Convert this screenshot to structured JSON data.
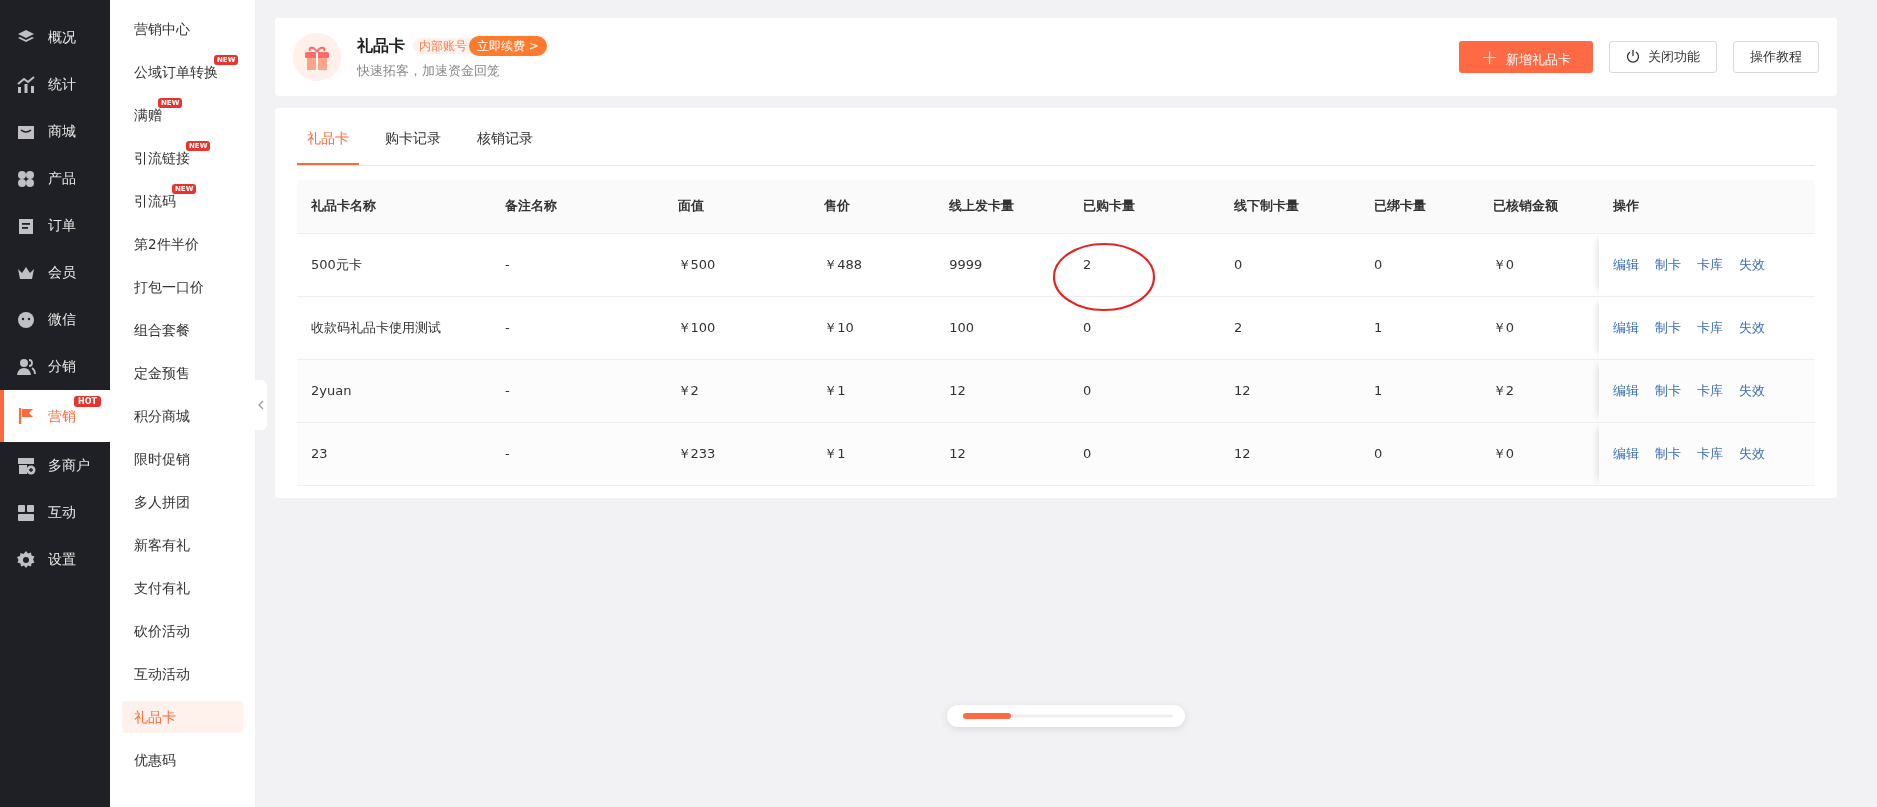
{
  "nav": [
    {
      "label": "概况",
      "selected": false
    },
    {
      "label": "统计",
      "selected": false
    },
    {
      "label": "商城",
      "selected": false
    },
    {
      "label": "产品",
      "selected": false
    },
    {
      "label": "订单",
      "selected": false
    },
    {
      "label": "会员",
      "selected": false
    },
    {
      "label": "微信",
      "selected": false
    },
    {
      "label": "分销",
      "selected": false
    },
    {
      "label": "营销",
      "selected": true,
      "badge": "HOT"
    },
    {
      "label": "多商户",
      "selected": false
    },
    {
      "label": "互动",
      "selected": false
    },
    {
      "label": "设置",
      "selected": false
    }
  ],
  "submenu": [
    {
      "label": "营销中心",
      "selected": false
    },
    {
      "label": "公域订单转换",
      "selected": false,
      "badge": "NEW"
    },
    {
      "label": "满赠",
      "selected": false,
      "badge": "NEW"
    },
    {
      "label": "引流链接",
      "selected": false,
      "badge": "NEW"
    },
    {
      "label": "引流码",
      "selected": false,
      "badge": "NEW"
    },
    {
      "label": "第2件半价",
      "selected": false
    },
    {
      "label": "打包一口价",
      "selected": false
    },
    {
      "label": "组合套餐",
      "selected": false
    },
    {
      "label": "定金预售",
      "selected": false
    },
    {
      "label": "积分商城",
      "selected": false
    },
    {
      "label": "限时促销",
      "selected": false
    },
    {
      "label": "多人拼团",
      "selected": false
    },
    {
      "label": "新客有礼",
      "selected": false
    },
    {
      "label": "支付有礼",
      "selected": false
    },
    {
      "label": "砍价活动",
      "selected": false
    },
    {
      "label": "互动活动",
      "selected": false
    },
    {
      "label": "礼品卡",
      "selected": true
    },
    {
      "label": "优惠码",
      "selected": false
    }
  ],
  "header": {
    "title": "礼品卡",
    "account_tag": "内部账号",
    "renew_button": "立即续费 >",
    "subtitle": "快速拓客，加速资金回笼",
    "buttons": [
      {
        "label": "新增礼品卡",
        "kind": "primary",
        "icon": "+"
      },
      {
        "label": "关闭功能",
        "kind": "power"
      },
      {
        "label": "操作教程",
        "kind": "plain"
      }
    ]
  },
  "tabs": [
    {
      "label": "礼品卡",
      "selected": true
    },
    {
      "label": "购卡记录",
      "selected": false
    },
    {
      "label": "核销记录",
      "selected": false
    }
  ],
  "table": {
    "columns": [
      "礼品卡名称",
      "备注名称",
      "面值",
      "售价",
      "线上发卡量",
      "已购卡量",
      "线下制卡量",
      "已绑卡量",
      "已核销金额",
      "操作"
    ],
    "rows": [
      {
        "cells": [
          {
            "text": "500元卡",
            "circled": false
          },
          {
            "text": "-",
            "circled": false
          },
          {
            "text": "￥500",
            "circled": false
          },
          {
            "text": "￥488",
            "circled": false
          },
          {
            "text": "9999",
            "circled": false
          },
          {
            "text": "2",
            "circled": true
          },
          {
            "text": "0",
            "circled": false
          },
          {
            "text": "0",
            "circled": false
          },
          {
            "text": "￥0",
            "circled": false
          }
        ],
        "actions": [
          "编辑",
          "制卡",
          "卡库",
          "失效"
        ]
      },
      {
        "cells": [
          {
            "text": "收款码礼品卡使用测试",
            "circled": false
          },
          {
            "text": "-",
            "circled": false
          },
          {
            "text": "￥100",
            "circled": false
          },
          {
            "text": "￥10",
            "circled": false
          },
          {
            "text": "100",
            "circled": false
          },
          {
            "text": "0",
            "circled": false
          },
          {
            "text": "2",
            "circled": false
          },
          {
            "text": "1",
            "circled": false
          },
          {
            "text": "￥0",
            "circled": false
          }
        ],
        "actions": [
          "编辑",
          "制卡",
          "卡库",
          "失效"
        ]
      },
      {
        "cells": [
          {
            "text": "2yuan",
            "circled": false
          },
          {
            "text": "-",
            "circled": false
          },
          {
            "text": "￥2",
            "circled": false
          },
          {
            "text": "￥1",
            "circled": false
          },
          {
            "text": "12",
            "circled": false
          },
          {
            "text": "0",
            "circled": false
          },
          {
            "text": "12",
            "circled": false
          },
          {
            "text": "1",
            "circled": false
          },
          {
            "text": "￥2",
            "circled": false
          }
        ],
        "actions": [
          "编辑",
          "制卡",
          "卡库",
          "失效"
        ]
      },
      {
        "cells": [
          {
            "text": "23",
            "circled": false
          },
          {
            "text": "-",
            "circled": false
          },
          {
            "text": "￥233",
            "circled": false
          },
          {
            "text": "￥1",
            "circled": false
          },
          {
            "text": "12",
            "circled": false
          },
          {
            "text": "0",
            "circled": false
          },
          {
            "text": "12",
            "circled": false
          },
          {
            "text": "0",
            "circled": false
          },
          {
            "text": "￥0",
            "circled": false
          }
        ],
        "actions": [
          "编辑",
          "制卡",
          "卡库",
          "失效"
        ]
      }
    ]
  }
}
